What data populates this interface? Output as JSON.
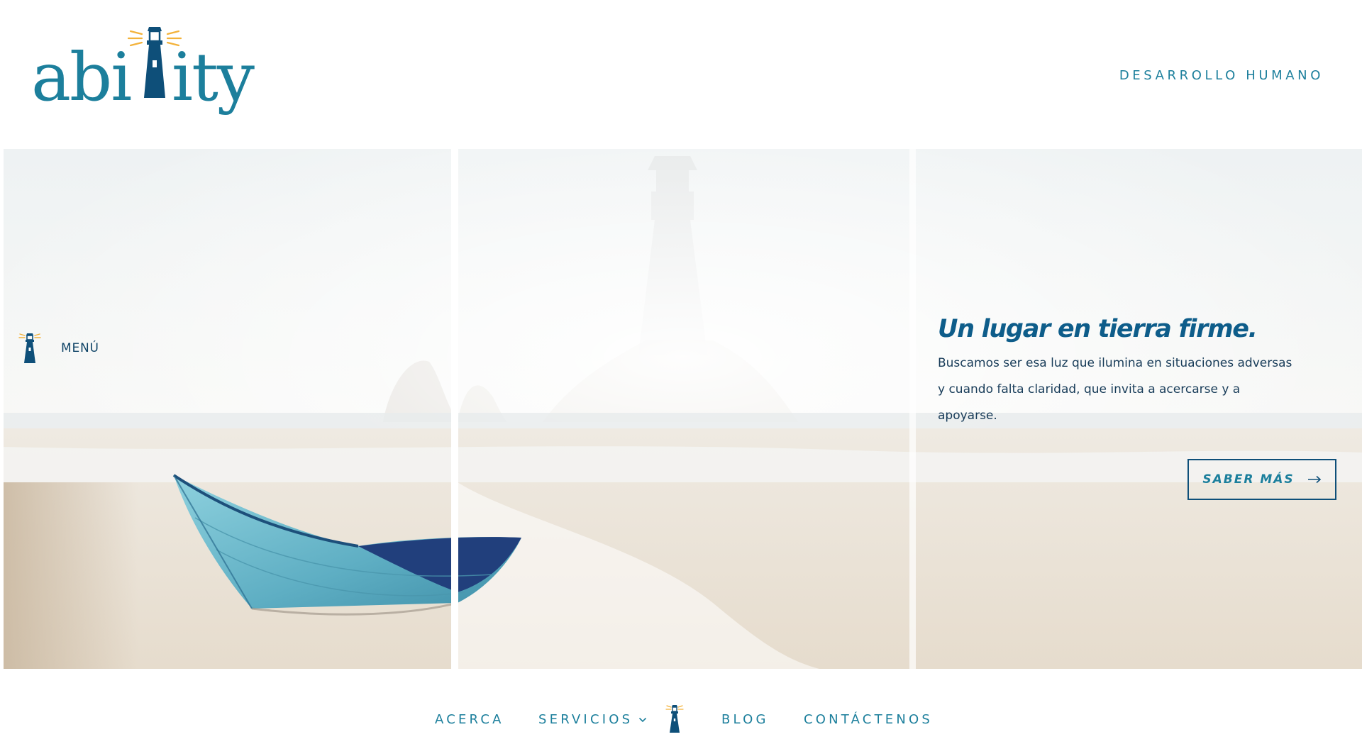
{
  "header": {
    "logo_text": "abi ity",
    "tagline": "DESARROLLO HUMANO"
  },
  "hero": {
    "menu_label": "MENÚ",
    "title": "Un lugar en tierra firme.",
    "body": "Buscamos ser esa luz que ilumina en situaciones adversas y cuando falta claridad, que invita a acercarse y a apoyarse.",
    "cta_label": "SABER MÁS"
  },
  "nav": {
    "items": [
      {
        "label": "ACERCA"
      },
      {
        "label": "SERVICIOS",
        "has_dropdown": true
      },
      {
        "label": "BLOG"
      },
      {
        "label": "CONTÁCTENOS"
      }
    ]
  },
  "colors": {
    "brand_teal": "#1c7f9c",
    "brand_navy": "#0e4f79",
    "light_yellow": "#f3b23a",
    "boat_blue": "#6ab6c9"
  },
  "icons": {
    "logo_mark": "lighthouse-icon",
    "menu": "lighthouse-icon",
    "cta": "arrow-right-icon",
    "dropdown": "chevron-down-icon"
  }
}
